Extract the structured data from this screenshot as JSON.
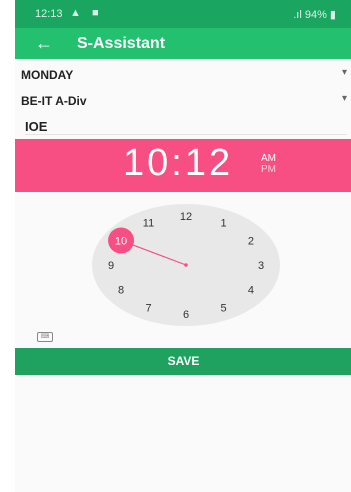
{
  "status_bar": {
    "time": "12:13",
    "icons": "▲ ■",
    "battery": ".ıl 94% ▮"
  },
  "app_bar": {
    "back_icon": "←",
    "title": "S-Assistant"
  },
  "form": {
    "day_select": {
      "value": "MONDAY",
      "caret": "▾"
    },
    "class_select": {
      "value": "BE-IT A-Div",
      "caret": "▾"
    },
    "subject_input": {
      "value": "IOE"
    }
  },
  "time_picker": {
    "time": "10:12",
    "am": "AM",
    "pm": "PM",
    "selected_hour": 10,
    "hours": [
      "12",
      "1",
      "2",
      "3",
      "4",
      "5",
      "6",
      "7",
      "8",
      "9",
      "10",
      "11"
    ]
  },
  "keyboard_toggle_icon": "keyboard-icon",
  "save_button": {
    "label": "SAVE"
  },
  "colors": {
    "status_bar": "#1aa561",
    "app_bar": "#22c06f",
    "header": "#f74f83",
    "accent": "#f74f83",
    "save_button": "#1fa25f",
    "dial": "#e8e8e8"
  }
}
